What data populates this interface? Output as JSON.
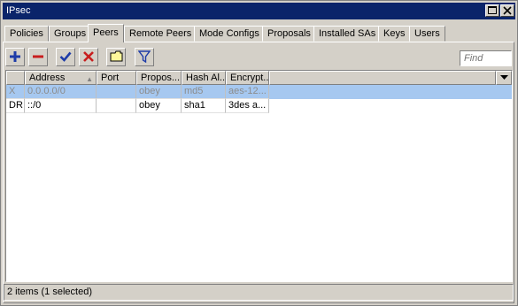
{
  "window": {
    "title": "IPsec"
  },
  "tabs": [
    {
      "label": "Policies"
    },
    {
      "label": "Groups"
    },
    {
      "label": "Peers",
      "active": true
    },
    {
      "label": "Remote Peers"
    },
    {
      "label": "Mode Configs"
    },
    {
      "label": "Proposals"
    },
    {
      "label": "Installed SAs"
    },
    {
      "label": "Keys"
    },
    {
      "label": "Users"
    }
  ],
  "toolbar": {
    "buttons": [
      "add-icon",
      "remove-icon",
      "enable-icon",
      "disable-icon",
      "comment-icon",
      "filter-icon"
    ],
    "find_placeholder": "Find"
  },
  "colors": {
    "titlebar": "#0a246a",
    "selected_row": "#a6c8f0",
    "add": "#1e3ca8",
    "remove": "#c81e1e",
    "enable": "#1e3ca8",
    "disable": "#c81e1e"
  },
  "table": {
    "columns": [
      "",
      "Address",
      "Port",
      "Propos...",
      "Hash Al...",
      "Encrypt..."
    ],
    "sort_column": "Address",
    "rows": [
      {
        "flags": "X",
        "address": "0.0.0.0/0",
        "port": "",
        "proposal": "obey",
        "hash": "md5",
        "encryption": "aes-12...",
        "selected": true,
        "disabled": true
      },
      {
        "flags": "DR",
        "address": "::/0",
        "port": "",
        "proposal": "obey",
        "hash": "sha1",
        "encryption": "3des a...",
        "selected": false,
        "disabled": false
      }
    ]
  },
  "status": {
    "text": "2 items (1 selected)"
  }
}
